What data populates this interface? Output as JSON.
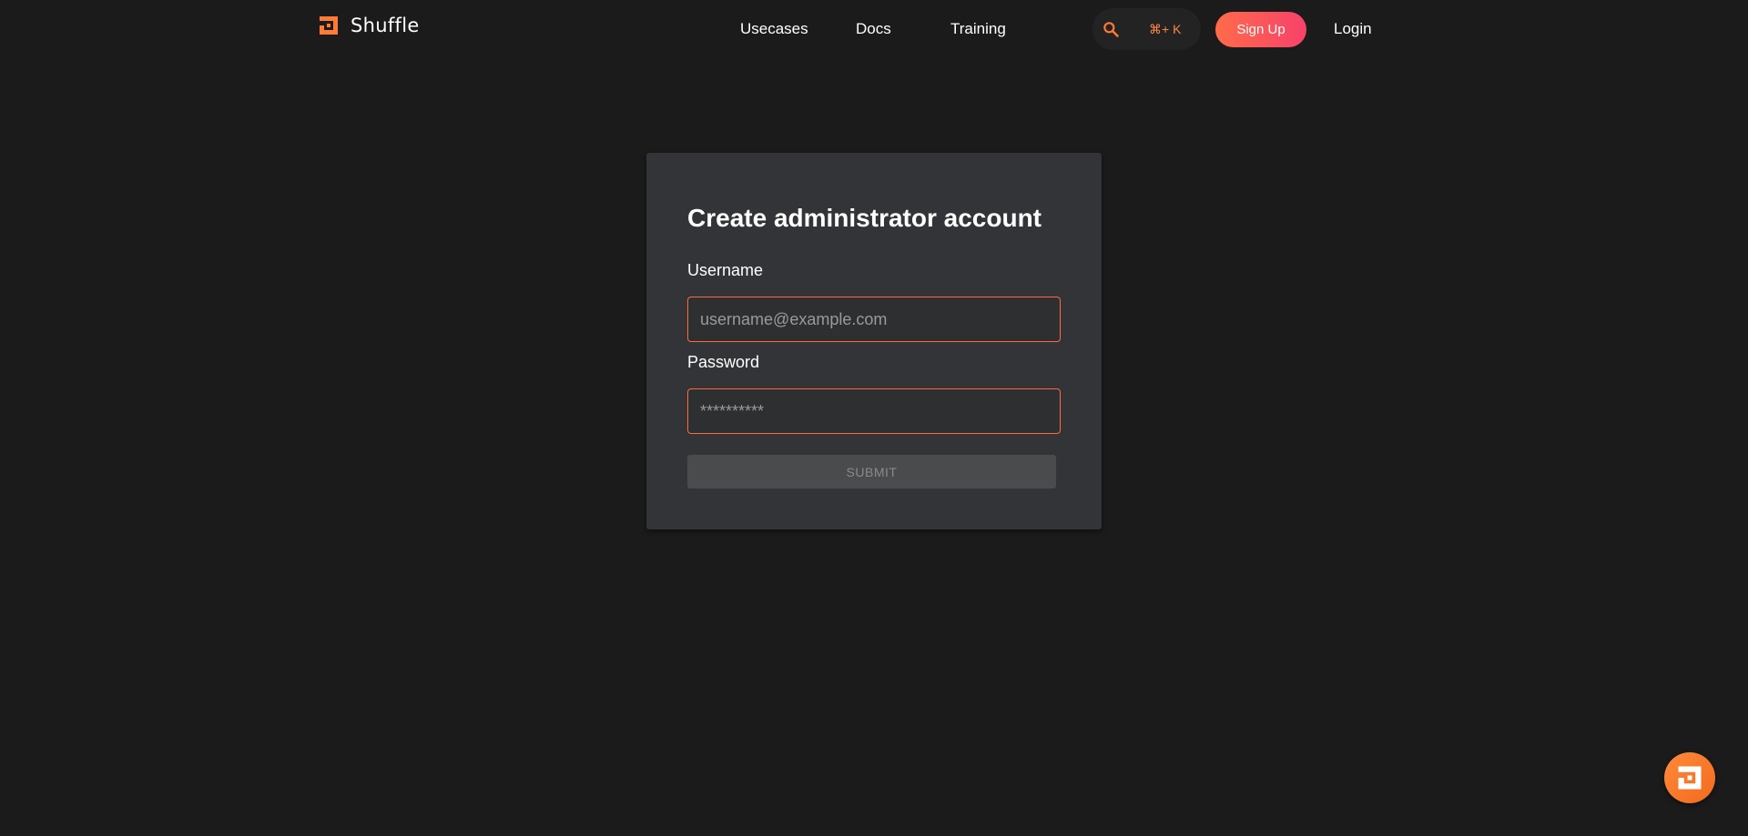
{
  "header": {
    "brand": "Shuffle",
    "nav": [
      {
        "label": "Usecases"
      },
      {
        "label": "Docs"
      },
      {
        "label": "Training"
      }
    ],
    "search_shortcut": "⌘+ K",
    "signup_label": "Sign Up",
    "login_label": "Login"
  },
  "form": {
    "title": "Create administrator account",
    "username_label": "Username",
    "username_placeholder": "username@example.com",
    "username_value": "",
    "password_label": "Password",
    "password_placeholder": "**********",
    "password_value": "",
    "submit_label": "SUBMIT"
  },
  "colors": {
    "accent": "#ff6a3d",
    "background": "#1b1b1b",
    "card": "#333437",
    "signup_gradient_start": "#ff6b4a",
    "signup_gradient_end": "#f7426a"
  },
  "icons": {
    "logo": "shuffle-logo-icon",
    "search": "search-icon",
    "chat": "shuffle-chat-icon"
  }
}
